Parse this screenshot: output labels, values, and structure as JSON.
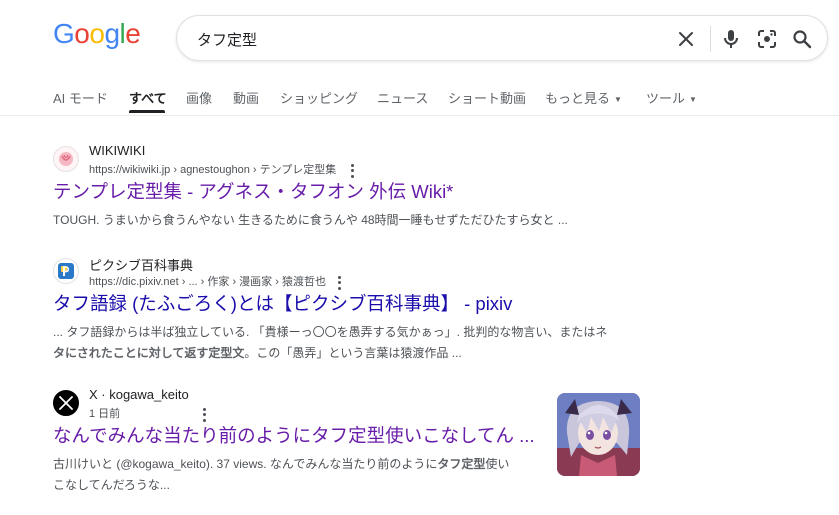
{
  "logo": {
    "letters": [
      "G",
      "o",
      "o",
      "g",
      "l",
      "e"
    ],
    "colors": [
      "#4285F4",
      "#EA4335",
      "#FBBC05",
      "#4285F4",
      "#34A853",
      "#EA4335"
    ]
  },
  "search": {
    "query": "タフ定型"
  },
  "icons": {
    "clear": "close-icon",
    "voice": "microphone-icon",
    "lens": "camera-icon",
    "search": "search-icon"
  },
  "tabs": [
    {
      "label": "AI モード"
    },
    {
      "label": "すべて",
      "active": true
    },
    {
      "label": "画像"
    },
    {
      "label": "動画"
    },
    {
      "label": "ショッピング"
    },
    {
      "label": "ニュース"
    },
    {
      "label": "ショート動画"
    },
    {
      "label": "もっと見る",
      "dropdown": true
    },
    {
      "label": "ツール",
      "dropdown": true
    }
  ],
  "results": [
    {
      "site_name": "WIKIWIKI",
      "url": "https://wikiwiki.jp › agnestoughon › テンプレ定型集",
      "title": "テンプレ定型集 - アグネス・タフオン 外伝 Wiki*",
      "snippet_1": "TOUGH. うまいから食うんやない 生きるために食うんや 48時間一睡もせずただひたすら女と ...",
      "favicon": "wikiwiki-favicon",
      "visited": true
    },
    {
      "site_name": "ピクシブ百科事典",
      "url": "https://dic.pixiv.net › ... › 作家 › 漫画家 › 猿渡哲也",
      "title": "タフ語録 (たふごろく)とは【ピクシブ百科事典】 - pixiv",
      "snippet_1a": "... タフ語録からは半ば独立している. 「貴様ーっ〇〇を愚弄する気かぁっ」. 批判的な物言い、またはネ",
      "snippet_2a": "タにされたことに対して返す定型文",
      "snippet_2b": "。この「愚弄」という言葉は猿渡作品 ...",
      "favicon": "pixiv-dictionary-favicon",
      "visited": false
    },
    {
      "site_name": "X · kogawa_keito",
      "url": "1 日前",
      "title": "なんでみんな当たり前のようにタフ定型使いこなしてん ...",
      "snippet_1a": "古川けいと (@kogawa_keito). 37 views. なんでみんな当たり前のように",
      "snippet_1b": "タフ定型",
      "snippet_1c": "使い",
      "snippet_2": "こなしてんだろうな...",
      "favicon": "x-favicon",
      "thumbnail": "anime-character-thumbnail",
      "visited": true
    }
  ]
}
